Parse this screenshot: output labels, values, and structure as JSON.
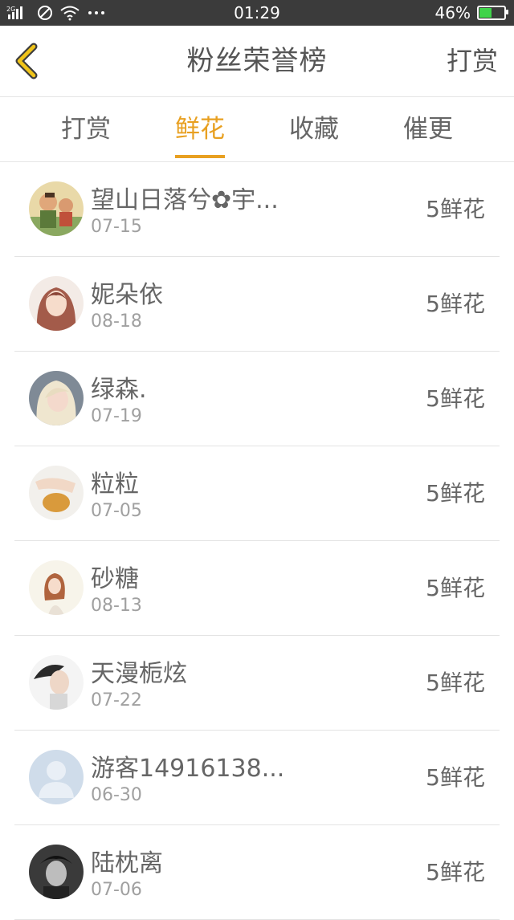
{
  "status_bar": {
    "signal": "2G",
    "time": "01:29",
    "battery": "46%",
    "battery_level": 0.46
  },
  "header": {
    "title": "粉丝荣誉榜",
    "right_action": "打赏"
  },
  "tabs": [
    {
      "label": "打赏",
      "active": false
    },
    {
      "label": "鲜花",
      "active": true
    },
    {
      "label": "收藏",
      "active": false
    },
    {
      "label": "催更",
      "active": false
    }
  ],
  "fans": [
    {
      "name": "望山日落兮✿宇...",
      "date": "07-15",
      "amount": "5鲜花"
    },
    {
      "name": "妮朵依",
      "date": "08-18",
      "amount": "5鲜花"
    },
    {
      "name": "绿森.",
      "date": "07-19",
      "amount": "5鲜花"
    },
    {
      "name": "粒粒",
      "date": "07-05",
      "amount": "5鲜花"
    },
    {
      "name": "砂糖",
      "date": "08-13",
      "amount": "5鲜花"
    },
    {
      "name": "天漫栀炫",
      "date": "07-22",
      "amount": "5鲜花"
    },
    {
      "name": "游客14916138...",
      "date": "06-30",
      "amount": "5鲜花"
    },
    {
      "name": "陆枕离",
      "date": "07-06",
      "amount": "5鲜花"
    }
  ],
  "colors": {
    "accent": "#e8a021",
    "status_bar": "#3b3b3b",
    "battery_fill": "#3fd34a"
  }
}
